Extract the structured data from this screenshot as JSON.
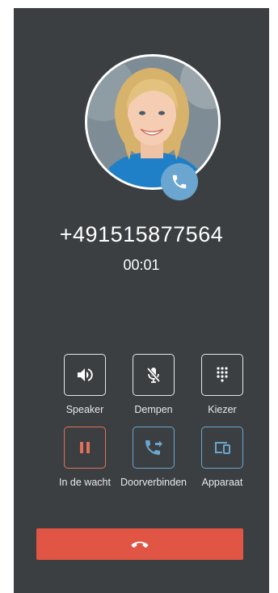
{
  "call": {
    "number": "+491515877564",
    "duration": "00:01"
  },
  "controls": {
    "speaker": {
      "label": "Speaker",
      "icon": "speaker-icon"
    },
    "mute": {
      "label": "Dempen",
      "icon": "mic-off-icon"
    },
    "dialpad": {
      "label": "Kiezer",
      "icon": "dialpad-icon"
    },
    "hold": {
      "label": "In de wacht",
      "icon": "pause-icon"
    },
    "transfer": {
      "label": "Doorverbinden",
      "icon": "call-transfer-icon"
    },
    "device": {
      "label": "Apparaat",
      "icon": "devices-icon"
    }
  },
  "hangup": {
    "icon": "hang-up-icon"
  },
  "colors": {
    "background": "#3b3f42",
    "accent_blue": "#6aa6cf",
    "accent_orange": "#e2705a",
    "hangup_red": "#e05544"
  }
}
